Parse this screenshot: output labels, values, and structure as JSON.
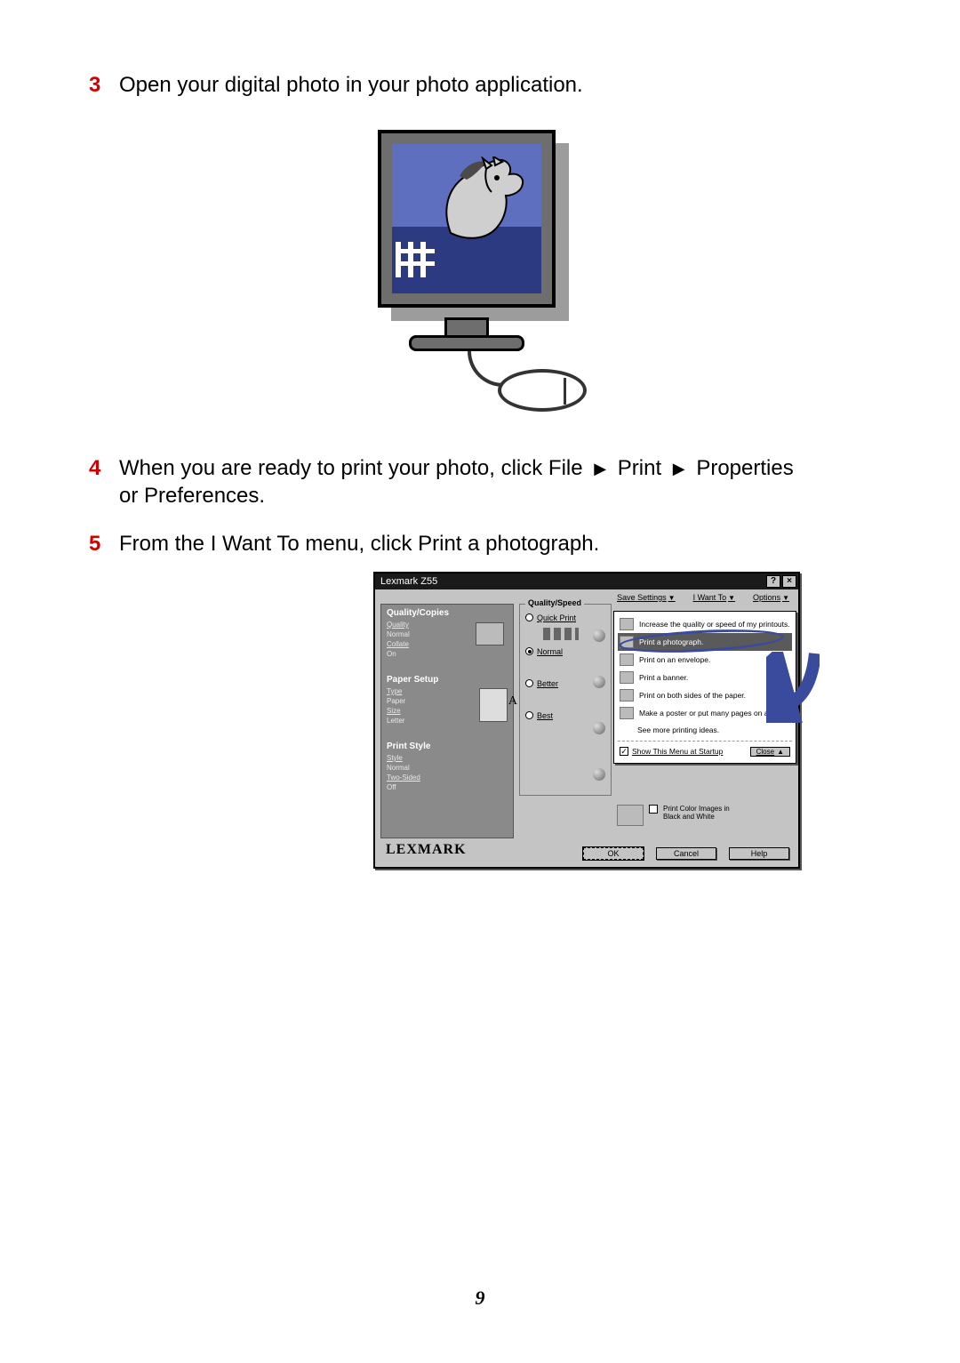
{
  "steps": {
    "s3": {
      "num": "3",
      "text": "Open your digital photo in your photo application."
    },
    "s4": {
      "num": "4",
      "pre": "When you are ready to print your photo, click File",
      "p1": "Print",
      "p2": "Properties",
      "post": "or Preferences."
    },
    "s5": {
      "num": "5",
      "text": "From the I Want To menu, click Print a photograph."
    }
  },
  "callout": "I Want To menu",
  "dialog": {
    "title": "Lexmark Z55",
    "help": "?",
    "close": "×",
    "top": {
      "save": "Save Settings",
      "iwant": "I Want To",
      "options": "Options"
    },
    "sidebar": {
      "qc": {
        "title": "Quality/Copies",
        "quality_k": "Quality",
        "quality_v": "Normal",
        "collate_k": "Collate",
        "collate_v": "On"
      },
      "ps": {
        "title": "Paper Setup",
        "type_k": "Type",
        "type_v": "Paper",
        "size_k": "Size",
        "size_v": "Letter"
      },
      "pst": {
        "title": "Print Style",
        "style_k": "Style",
        "style_v": "Normal",
        "two_k": "Two-Sided",
        "two_v": "Off"
      }
    },
    "brand": "LEXMARK",
    "qs": {
      "title": "Quality/Speed",
      "quick": "Quick Print",
      "normal": "Normal",
      "better": "Better",
      "best": "Best"
    },
    "bw": {
      "line1": "Print Color Images in",
      "line2": "Black and White"
    },
    "menu": {
      "m1": "Increase the quality or speed of my printouts.",
      "m2": "Print a photograph.",
      "m3": "Print on an envelope.",
      "m4": "Print a banner.",
      "m5": "Print on both sides of the paper.",
      "m6": "Make a poster or put many pages on a sheet.",
      "m7": "See more printing ideas.",
      "show": "Show This Menu at Startup",
      "close": "Close"
    },
    "buttons": {
      "ok": "OK",
      "cancel": "Cancel",
      "help": "Help"
    }
  },
  "pagenum": "9"
}
